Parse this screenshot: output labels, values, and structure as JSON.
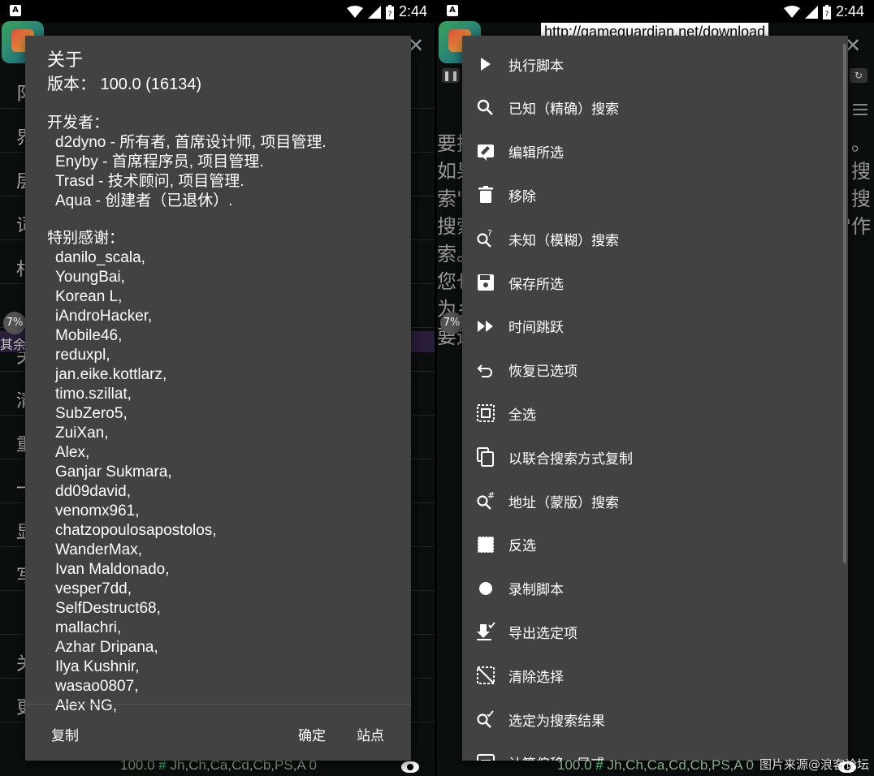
{
  "status_bar": {
    "time": "2:44",
    "notification_icon": "a-notification-icon"
  },
  "left": {
    "dialog": {
      "title": "关于",
      "version": "版本： 100.0 (16134)",
      "developers_header": "开发者：",
      "developers": [
        "d2dyno - 所有者, 首席设计师, 项目管理.",
        "Enyby - 首席程序员, 项目管理.",
        "Trasd - 技术顾问, 项目管理.",
        "Aqua - 创建者（已退休）."
      ],
      "thanks_header": "特别感谢：",
      "thanks": [
        "danilo_scala,",
        "YoungBai,",
        "Korean L,",
        "iAndroHacker,",
        "Mobile46,",
        "reduxpl,",
        "jan.eike.kottlarz,",
        "timo.szillat,",
        "SubZero5,",
        "ZuiXan,",
        "Alex,",
        "Ganjar Sukmara,",
        "dd09david,",
        "venomx961,",
        "chatzopoulosapostolos,",
        "WanderMax,",
        "Ivan Maldonado,",
        "vesper7dd,",
        "SelfDestruct68,",
        "mallachri,",
        "Azhar Dripana,",
        "Ilya Kushnir,",
        "wasao0807,",
        "Alex NG,"
      ],
      "actions": {
        "copy": "复制",
        "ok": "确定",
        "site": "站点"
      }
    },
    "bg_rows": [
      "阝",
      "界",
      "层",
      "词",
      "村",
      "",
      "关",
      "清",
      "重",
      "一",
      "显",
      "写",
      "",
      "关",
      "更"
    ],
    "bg_purple_text": "其余",
    "badge": "7%",
    "bottom": {
      "version": "100.0",
      "hash": "#",
      "text": "Jh,Ch,Ca,Cd,Cb,PS,A 0"
    }
  },
  "right": {
    "url": "http://gameguardian.net/download",
    "bg_text_left": [
      "要搜",
      "如果",
      "索\"",
      "搜索",
      "索。",
      "您也",
      "为乡",
      "要运"
    ],
    "bg_text_right": [
      "",
      "。",
      "搜",
      "",
      "搜",
      "",
      "\"作"
    ],
    "menu_items": [
      {
        "label": "执行脚本",
        "icon": "play-icon"
      },
      {
        "label": "已知（精确）搜索",
        "icon": "search-icon"
      },
      {
        "label": "编辑所选",
        "icon": "edit-selection-icon"
      },
      {
        "label": "移除",
        "icon": "trash-icon"
      },
      {
        "label": "未知（模糊）搜索",
        "icon": "fuzzy-search-icon"
      },
      {
        "label": "保存所选",
        "icon": "save-icon"
      },
      {
        "label": "时间跳跃",
        "icon": "fast-forward-icon"
      },
      {
        "label": "恢复已选项",
        "icon": "undo-icon"
      },
      {
        "label": "全选",
        "icon": "select-all-icon"
      },
      {
        "label": "以联合搜索方式复制",
        "icon": "copy-icon"
      },
      {
        "label": "地址（蒙版）搜索",
        "icon": "mask-search-icon"
      },
      {
        "label": "反选",
        "icon": "invert-selection-icon"
      },
      {
        "label": "录制脚本",
        "icon": "record-icon"
      },
      {
        "label": "导出选定项",
        "icon": "export-icon"
      },
      {
        "label": "清除选择",
        "icon": "clear-selection-icon"
      },
      {
        "label": "选定为搜索结果",
        "icon": "select-as-result-icon"
      },
      {
        "label": "计算偏移...异或",
        "icon": "calculator-icon"
      }
    ],
    "badge": "7%",
    "bottom": {
      "version": "100.0",
      "hash": "#",
      "text": "Jh,Ch,Ca,Cd,Cb,PS,A 0"
    }
  },
  "watermark": "图片来源@浪客论坛"
}
